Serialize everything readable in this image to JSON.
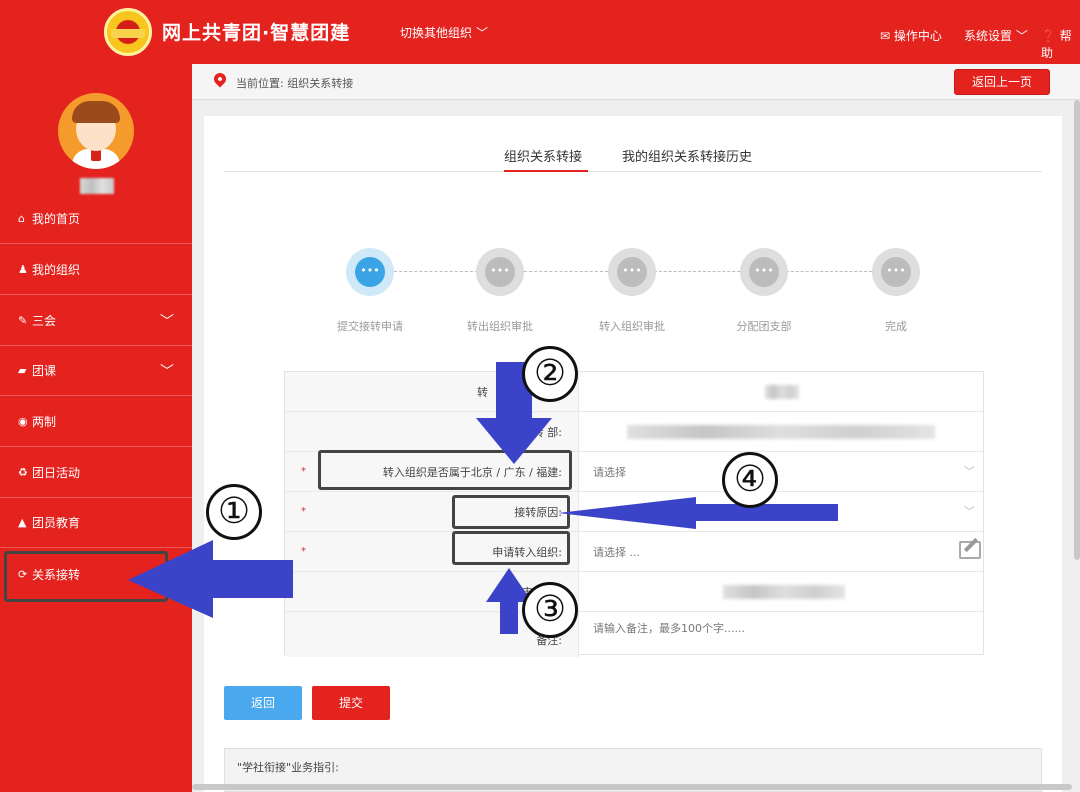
{
  "header": {
    "brand": "网上共青团·智慧团建",
    "switch_org": "切换其他组织",
    "ops_center": "操作中心",
    "sys_settings": "系统设置",
    "help": "帮助"
  },
  "sidebar": {
    "items": [
      {
        "icon": "home-icon",
        "label": "我的首页"
      },
      {
        "icon": "group-icon",
        "label": "我的组织"
      },
      {
        "icon": "edit-icon",
        "label": "三会"
      },
      {
        "icon": "folder-icon",
        "label": "团课"
      },
      {
        "icon": "circle-icon",
        "label": "两制"
      },
      {
        "icon": "recycle-icon",
        "label": "团日活动"
      },
      {
        "icon": "graduation-icon",
        "label": "团员教育"
      },
      {
        "icon": "refresh-icon",
        "label": "关系接转"
      }
    ]
  },
  "breadcrumb": {
    "text": "当前位置: 组织关系转接",
    "back_button": "返回上一页"
  },
  "tabs": [
    "组织关系转接",
    "我的组织关系转接历史"
  ],
  "steps": [
    {
      "label": "提交接转申请",
      "state": "active"
    },
    {
      "label": "转出组织审批",
      "state": "pending"
    },
    {
      "label": "转入组织审批",
      "state": "pending"
    },
    {
      "label": "分配团支部",
      "state": "pending"
    },
    {
      "label": "完成",
      "state": "pending"
    }
  ],
  "form": {
    "row1_label": "转",
    "row2_label": "转 部:",
    "row3_label": "转入组织是否属于北京 / 广东 / 福建:",
    "row3_value": "请选择",
    "row4_label": "接转原因:",
    "row5_label": "申请转入组织:",
    "row5_value": "请选择 ...",
    "row6_label": "申 时间:",
    "row7_label": "备注:",
    "row7_placeholder": "请输入备注，最多100个字......",
    "required_mark": "*"
  },
  "buttons": {
    "back": "返回",
    "submit": "提交"
  },
  "guide": "\"学社衔接\"业务指引:",
  "annotations": [
    "①",
    "②",
    "③",
    "④"
  ],
  "colors": {
    "brand_red": "#e4221e",
    "active_blue": "#3aa4e6",
    "arrow_blue": "#3b44c9"
  }
}
